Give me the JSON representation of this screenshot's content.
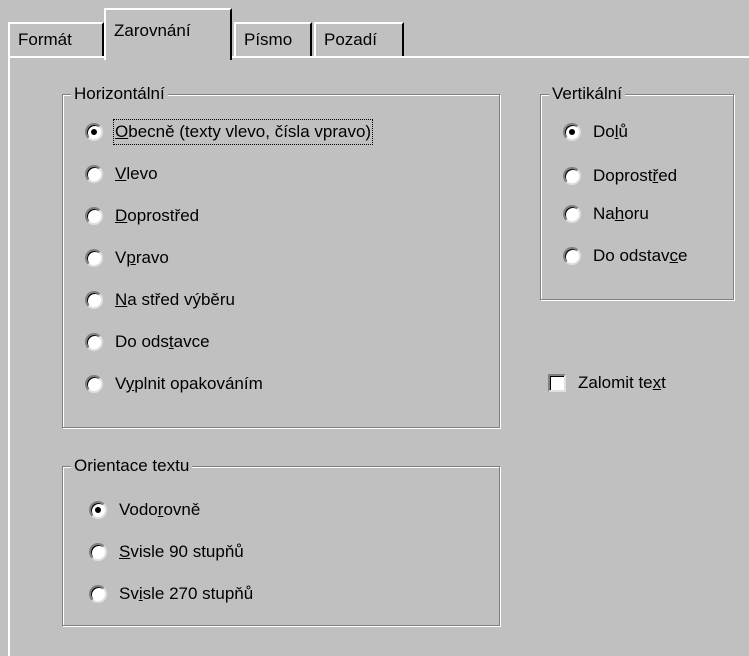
{
  "tabs": [
    {
      "label": "Formát",
      "active": false
    },
    {
      "label": "Zarovnání",
      "active": true
    },
    {
      "label": "Písmo",
      "active": false
    },
    {
      "label": "Pozadí",
      "active": false
    }
  ],
  "horizontal": {
    "legend": "Horizontální",
    "options": [
      {
        "pre": "",
        "ul": "O",
        "post": "becně (texty vlevo, čísla  vpravo)",
        "checked": true
      },
      {
        "pre": "",
        "ul": "V",
        "post": "levo",
        "checked": false
      },
      {
        "pre": "",
        "ul": "D",
        "post": "oprostřed",
        "checked": false
      },
      {
        "pre": "V",
        "ul": "p",
        "post": "ravo",
        "checked": false
      },
      {
        "pre": "",
        "ul": "N",
        "post": "a střed výběru",
        "checked": false
      },
      {
        "pre": "Do ods",
        "ul": "t",
        "post": "avce",
        "checked": false
      },
      {
        "pre": "V",
        "ul": "y",
        "post": "plnit opakováním",
        "checked": false
      }
    ]
  },
  "orientation": {
    "legend": "Orientace textu",
    "options": [
      {
        "pre": "Vodo",
        "ul": "r",
        "post": "ovně",
        "checked": true
      },
      {
        "pre": "",
        "ul": "S",
        "post": "visle 90 stupňů",
        "checked": false
      },
      {
        "pre": "Sv",
        "ul": "i",
        "post": "sle 270 stupňů",
        "checked": false
      }
    ]
  },
  "vertical": {
    "legend": "Vertikální",
    "options": [
      {
        "pre": "Do",
        "ul": "l",
        "post": "ů",
        "checked": true
      },
      {
        "pre": "Doprost",
        "ul": "ř",
        "post": "ed",
        "checked": false
      },
      {
        "pre": "Na",
        "ul": "h",
        "post": "oru",
        "checked": false
      },
      {
        "pre": "Do odstav",
        "ul": "c",
        "post": "e",
        "checked": false
      }
    ]
  },
  "wrap": {
    "pre": "Zalomit te",
    "ul": "x",
    "post": "t",
    "checked": false
  }
}
